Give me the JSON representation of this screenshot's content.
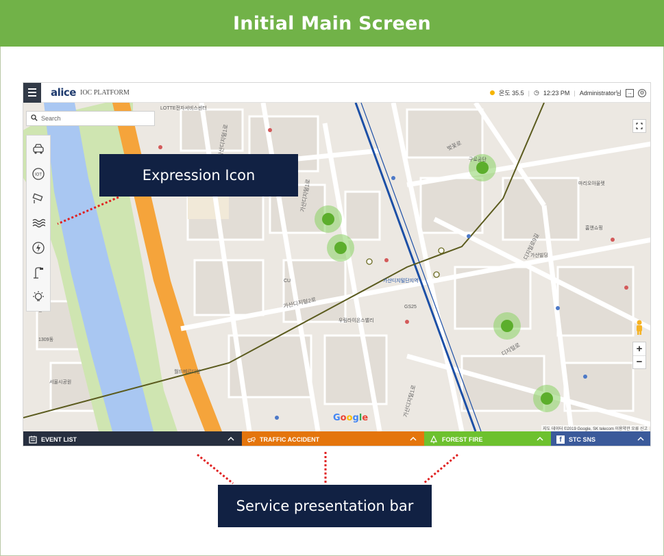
{
  "slide": {
    "title": "Initial Main Screen",
    "header_color": "#71b248"
  },
  "app": {
    "brand": "alice",
    "platform": "IOC PLATFORM",
    "status": {
      "weather": "온도 35.5",
      "time": "12:23 PM",
      "user": "Administrator님"
    }
  },
  "search": {
    "placeholder": "Search"
  },
  "sidebar_tools": [
    {
      "name": "traffic-car-icon"
    },
    {
      "name": "iot-icon"
    },
    {
      "name": "cctv-icon"
    },
    {
      "name": "flood-icon"
    },
    {
      "name": "power-icon"
    },
    {
      "name": "streetlight-icon"
    },
    {
      "name": "light-bulb-icon"
    }
  ],
  "map": {
    "road_labels": [
      "가산디지털1로",
      "가산디지털1로",
      "가산디지털2로",
      "디지털로",
      "벚꽃로",
      "디지털로9길",
      "가산디지털1로"
    ],
    "place_labels": [
      "가산디지털단지역",
      "LOTTE전자서비스센터",
      "GS25",
      "CU",
      "마리오아울렛",
      "구로공단",
      "1307동",
      "1309동",
      "우림라이온스밸리",
      "가산빌딩",
      "홈앤쇼핑",
      "월드메르디앙",
      "서울시공원"
    ],
    "google": "Google",
    "credit": "지도 데이터 ©2019 Google, SK telecom  이용약관  오류 신고"
  },
  "service_bar": {
    "tabs": [
      {
        "label": "EVENT LIST",
        "color": "#272f3f"
      },
      {
        "label": "TRAFFIC ACCIDENT",
        "color": "#e4750c"
      },
      {
        "label": "FOREST FIRE",
        "color": "#6dc12e"
      },
      {
        "label": "STC SNS",
        "color": "#3b5a9a"
      }
    ]
  },
  "annotations": {
    "expression_icon": "Expression Icon",
    "service_bar": "Service presentation bar",
    "box_color": "#112143",
    "line_color": "#e02020"
  }
}
